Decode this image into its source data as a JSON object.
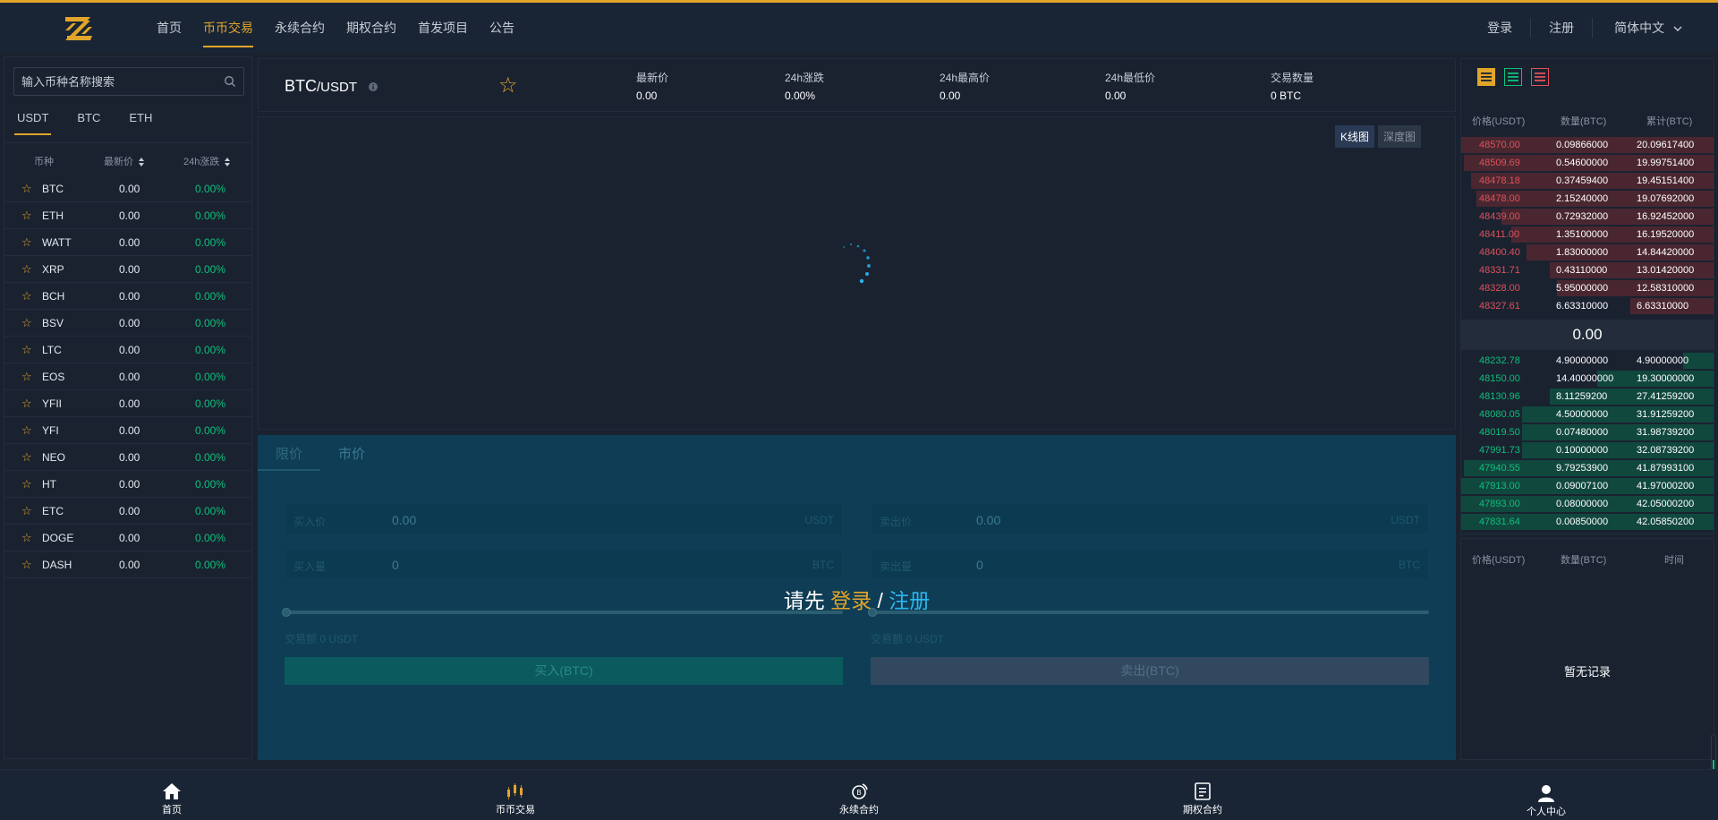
{
  "header": {
    "nav": [
      "首页",
      "币币交易",
      "永续合约",
      "期权合约",
      "首发项目",
      "公告"
    ],
    "active_nav": "币币交易",
    "login": "登录",
    "register": "注册",
    "language": "简体中文"
  },
  "market": {
    "search_placeholder": "输入币种名称搜索",
    "tabs": [
      "USDT",
      "BTC",
      "ETH"
    ],
    "active_tab": "USDT",
    "columns": {
      "coin": "币种",
      "price": "最新价",
      "change": "24h涨跌"
    },
    "rows": [
      {
        "symbol": "BTC",
        "price": "0.00",
        "change": "0.00%"
      },
      {
        "symbol": "ETH",
        "price": "0.00",
        "change": "0.00%"
      },
      {
        "symbol": "WATT",
        "price": "0.00",
        "change": "0.00%"
      },
      {
        "symbol": "XRP",
        "price": "0.00",
        "change": "0.00%"
      },
      {
        "symbol": "BCH",
        "price": "0.00",
        "change": "0.00%"
      },
      {
        "symbol": "BSV",
        "price": "0.00",
        "change": "0.00%"
      },
      {
        "symbol": "LTC",
        "price": "0.00",
        "change": "0.00%"
      },
      {
        "symbol": "EOS",
        "price": "0.00",
        "change": "0.00%"
      },
      {
        "symbol": "YFII",
        "price": "0.00",
        "change": "0.00%"
      },
      {
        "symbol": "YFI",
        "price": "0.00",
        "change": "0.00%"
      },
      {
        "symbol": "NEO",
        "price": "0.00",
        "change": "0.00%"
      },
      {
        "symbol": "HT",
        "price": "0.00",
        "change": "0.00%"
      },
      {
        "symbol": "ETC",
        "price": "0.00",
        "change": "0.00%"
      },
      {
        "symbol": "DOGE",
        "price": "0.00",
        "change": "0.00%"
      },
      {
        "symbol": "DASH",
        "price": "0.00",
        "change": "0.00%"
      }
    ]
  },
  "ticker": {
    "base": "BTC",
    "quote": "/USDT",
    "stats": [
      {
        "label": "最新价",
        "value": "0.00"
      },
      {
        "label": "24h涨跌",
        "value": "0.00%"
      },
      {
        "label": "24h最高价",
        "value": "0.00"
      },
      {
        "label": "24h最低价",
        "value": "0.00"
      },
      {
        "label": "交易数量",
        "value": "0 BTC"
      }
    ]
  },
  "chart": {
    "tabs": [
      "K线图",
      "深度图"
    ],
    "active_tab": "K线图"
  },
  "trade": {
    "tabs": [
      "限价",
      "市价"
    ],
    "active_tab": "限价",
    "buy": {
      "price_label": "买入价",
      "price_value": "0.00",
      "price_unit": "USDT",
      "amount_label": "买入量",
      "amount_value": "0",
      "amount_unit": "BTC",
      "total": "交易额 0 USDT",
      "button": "买入(BTC)"
    },
    "sell": {
      "price_label": "卖出价",
      "price_value": "0.00",
      "price_unit": "USDT",
      "amount_label": "卖出量",
      "amount_value": "0",
      "amount_unit": "BTC",
      "total": "交易额 0 USDT",
      "button": "卖出(BTC)"
    },
    "login_prompt": {
      "prefix": "请先",
      "login": "登录",
      "sep": "/",
      "register": "注册"
    }
  },
  "orderbook": {
    "columns": {
      "price": "价格(USDT)",
      "amount": "数量(BTC)",
      "total": "累计(BTC)"
    },
    "asks": [
      {
        "price": "48570.00",
        "amount": "0.09866000",
        "total": "20.09617400",
        "depth": 1.0
      },
      {
        "price": "48509.69",
        "amount": "0.54600000",
        "total": "19.99751400",
        "depth": 0.99
      },
      {
        "price": "48478.18",
        "amount": "0.37459400",
        "total": "19.45151400",
        "depth": 0.96
      },
      {
        "price": "48478.00",
        "amount": "2.15240000",
        "total": "19.07692000",
        "depth": 0.94
      },
      {
        "price": "48439.00",
        "amount": "0.72932000",
        "total": "16.92452000",
        "depth": 0.84
      },
      {
        "price": "48411.00",
        "amount": "1.35100000",
        "total": "16.19520000",
        "depth": 0.8
      },
      {
        "price": "48400.40",
        "amount": "1.83000000",
        "total": "14.84420000",
        "depth": 0.74
      },
      {
        "price": "48331.71",
        "amount": "0.43110000",
        "total": "13.01420000",
        "depth": 0.65
      },
      {
        "price": "48328.00",
        "amount": "5.95000000",
        "total": "12.58310000",
        "depth": 0.62
      },
      {
        "price": "48327.61",
        "amount": "6.63310000",
        "total": "6.63310000",
        "depth": 0.33
      }
    ],
    "last_price": "0.00",
    "bids": [
      {
        "price": "48232.78",
        "amount": "4.90000000",
        "total": "4.90000000",
        "depth": 0.12
      },
      {
        "price": "48150.00",
        "amount": "14.40000000",
        "total": "19.30000000",
        "depth": 0.46
      },
      {
        "price": "48130.96",
        "amount": "8.11259200",
        "total": "27.41259200",
        "depth": 0.65
      },
      {
        "price": "48080.05",
        "amount": "4.50000000",
        "total": "31.91259200",
        "depth": 0.76
      },
      {
        "price": "48019.50",
        "amount": "0.07480000",
        "total": "31.98739200",
        "depth": 0.76
      },
      {
        "price": "47991.73",
        "amount": "0.10000000",
        "total": "32.08739200",
        "depth": 0.76
      },
      {
        "price": "47940.55",
        "amount": "9.79253900",
        "total": "41.87993100",
        "depth": 0.99
      },
      {
        "price": "47913.00",
        "amount": "0.09007100",
        "total": "41.97000200",
        "depth": 1.0
      },
      {
        "price": "47893.00",
        "amount": "0.08000000",
        "total": "42.05000200",
        "depth": 1.0
      },
      {
        "price": "47831.64",
        "amount": "0.00850000",
        "total": "42.05850200",
        "depth": 1.0
      }
    ]
  },
  "trades": {
    "columns": {
      "price": "价格(USDT)",
      "amount": "数量(BTC)",
      "time": "时间"
    },
    "empty": "暂无记录"
  },
  "bottom_nav": [
    {
      "label": "首页",
      "icon": "home-icon"
    },
    {
      "label": "币币交易",
      "icon": "candlestick-icon"
    },
    {
      "label": "永续合约",
      "icon": "contract-icon"
    },
    {
      "label": "期权合约",
      "icon": "document-icon"
    },
    {
      "label": "个人中心",
      "icon": "user-icon"
    }
  ],
  "colors": {
    "accent": "#e2a52a",
    "up": "#0ebf7a",
    "down": "#e0505a",
    "register": "#2cb7f0"
  }
}
